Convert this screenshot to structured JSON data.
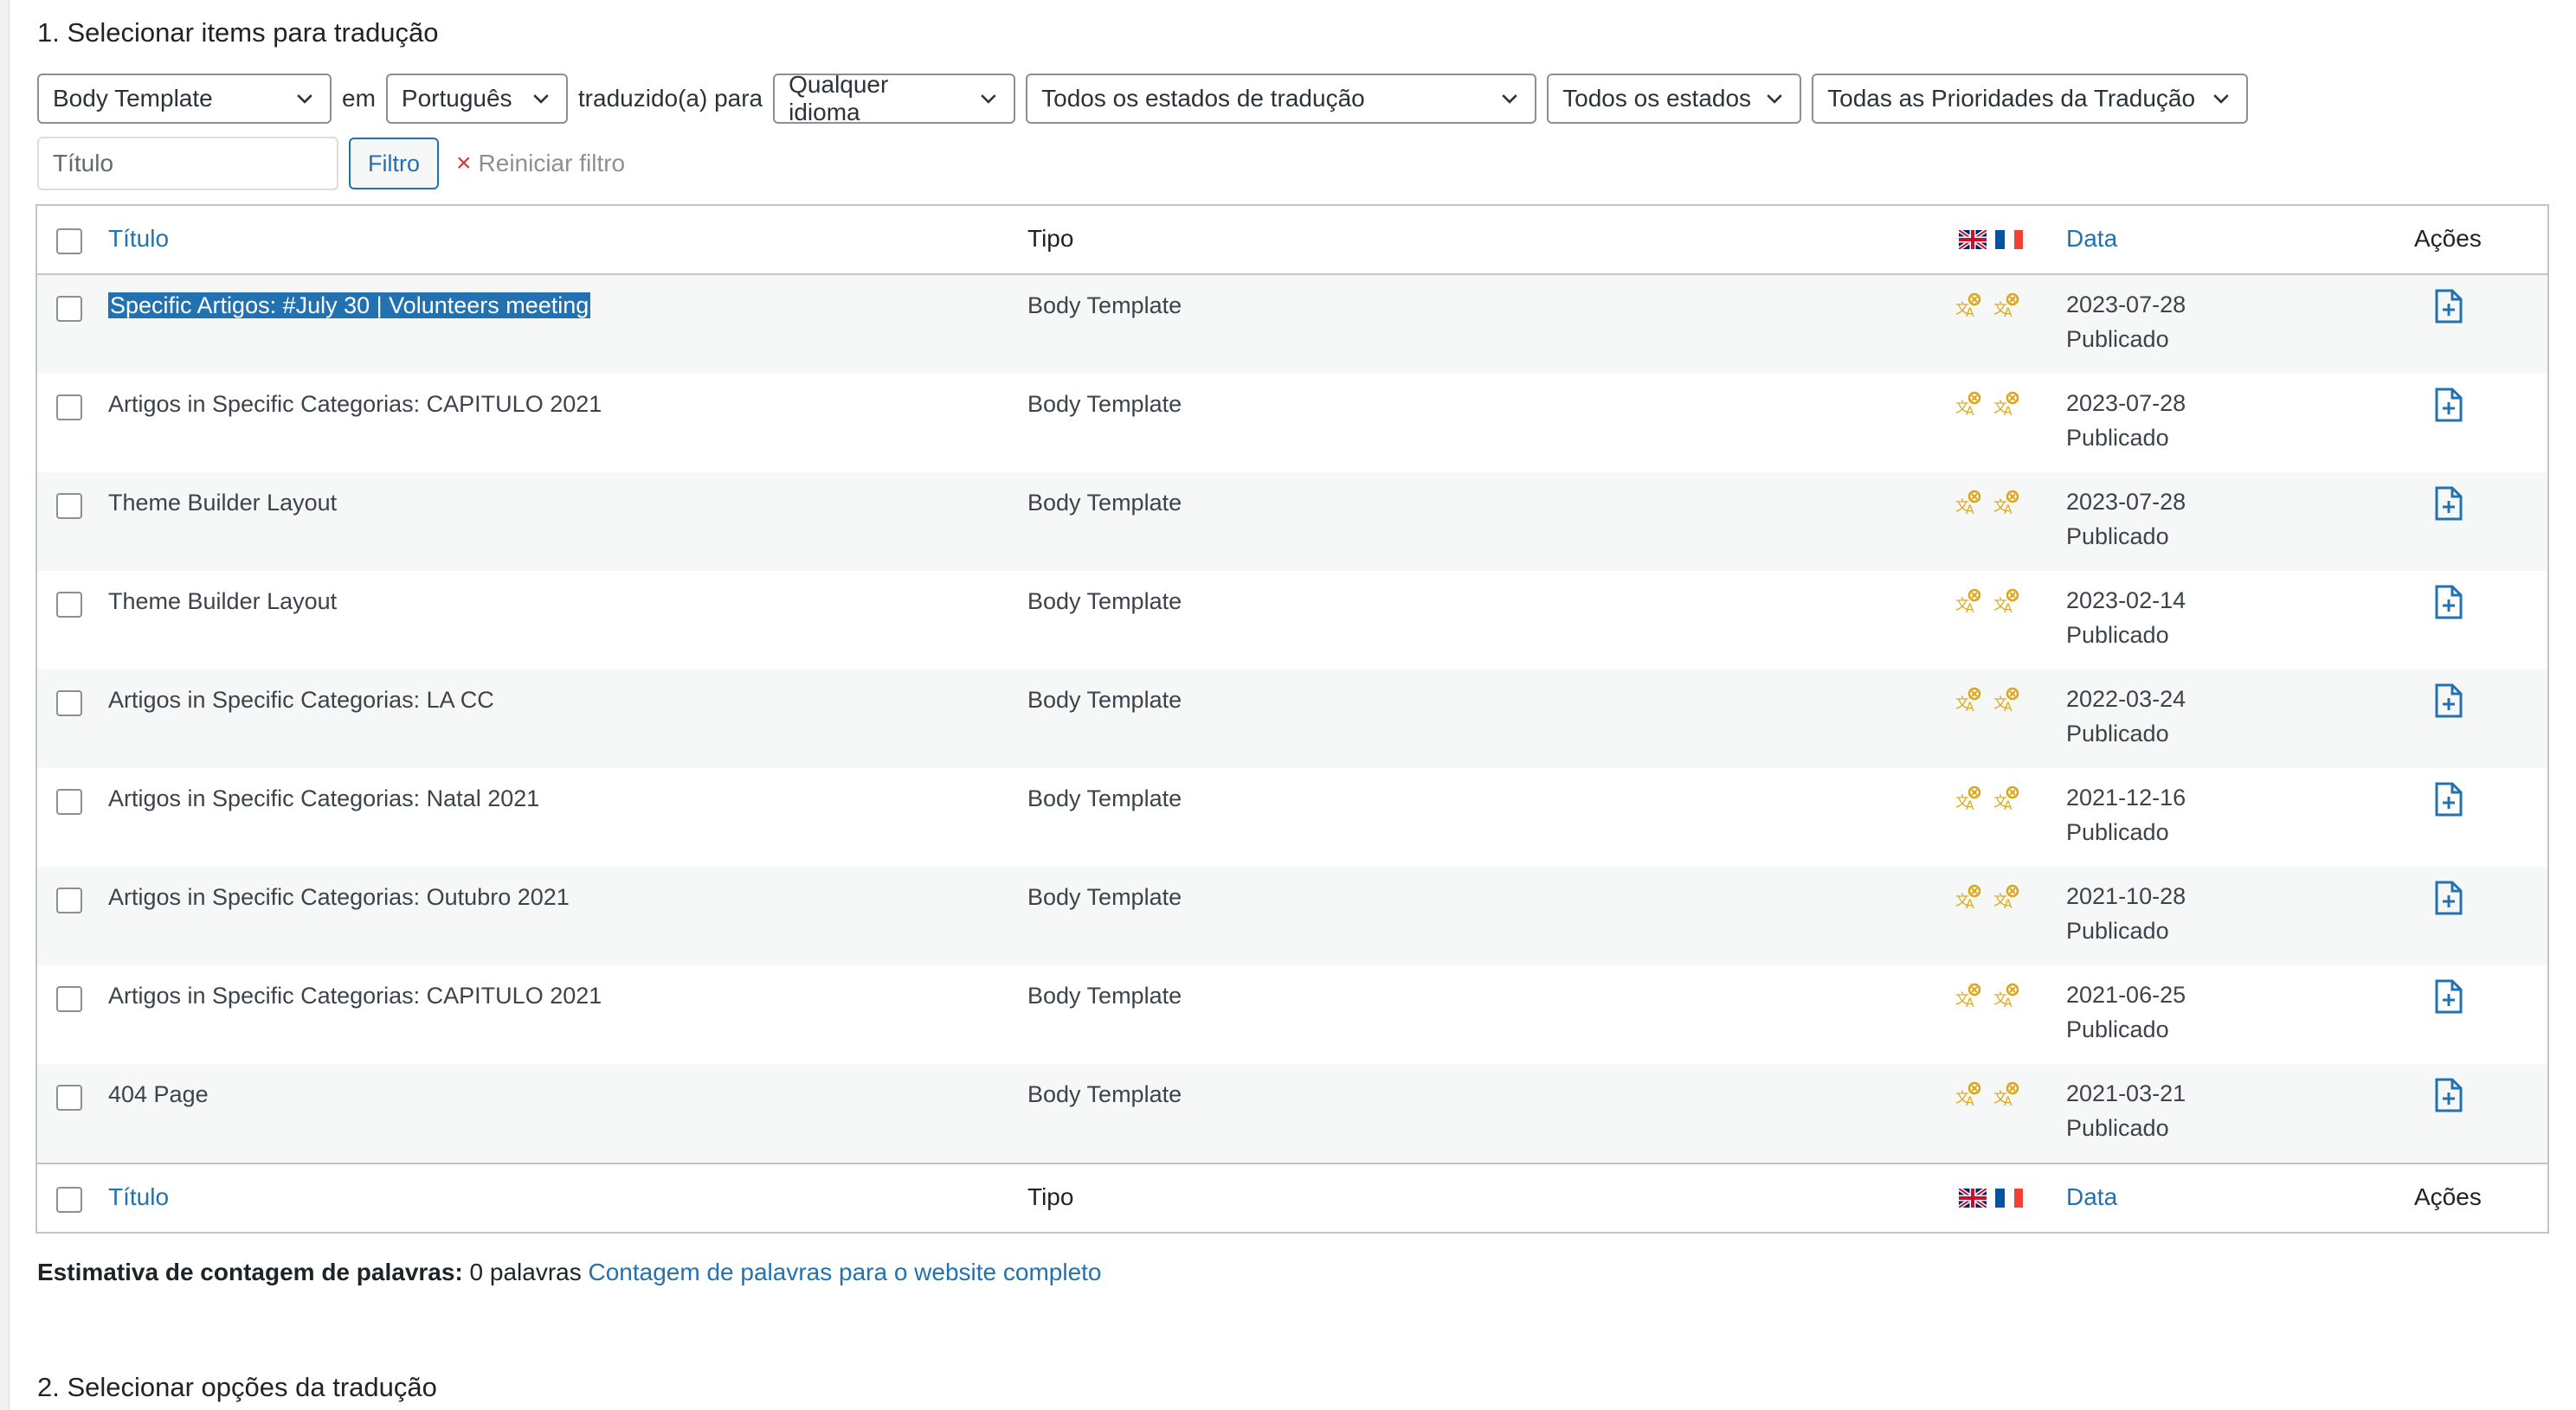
{
  "section1_title": "1. Selecionar items para tradução",
  "section2_title": "2. Selecionar opções da tradução",
  "filters": {
    "type_select": "Body Template",
    "in_label": "em",
    "language_select": "Português",
    "translated_to_label": "traduzido(a) para",
    "target_select": "Qualquer idioma",
    "translation_status_select": "Todos os estados de tradução",
    "status_select": "Todos os estados",
    "priority_select": "Todas as Prioridades da Tradução",
    "title_placeholder": "Título",
    "filter_button": "Filtro",
    "reset_label": "Reiniciar filtro"
  },
  "table": {
    "headers": {
      "title": "Título",
      "type": "Tipo",
      "date": "Data",
      "actions": "Ações"
    },
    "rows": [
      {
        "title": "Specific Artigos: #July 30 | Volunteers meeting",
        "type": "Body Template",
        "date": "2023-07-28",
        "status": "Publicado"
      },
      {
        "title": "Artigos in Specific Categorias: CAPITULO 2021",
        "type": "Body Template",
        "date": "2023-07-28",
        "status": "Publicado"
      },
      {
        "title": "Theme Builder Layout",
        "type": "Body Template",
        "date": "2023-07-28",
        "status": "Publicado"
      },
      {
        "title": "Theme Builder Layout",
        "type": "Body Template",
        "date": "2023-02-14",
        "status": "Publicado"
      },
      {
        "title": "Artigos in Specific Categorias: LA CC",
        "type": "Body Template",
        "date": "2022-03-24",
        "status": "Publicado"
      },
      {
        "title": "Artigos in Specific Categorias: Natal 2021",
        "type": "Body Template",
        "date": "2021-12-16",
        "status": "Publicado"
      },
      {
        "title": "Artigos in Specific Categorias: Outubro 2021",
        "type": "Body Template",
        "date": "2021-10-28",
        "status": "Publicado"
      },
      {
        "title": "Artigos in Specific Categorias: CAPITULO 2021",
        "type": "Body Template",
        "date": "2021-06-25",
        "status": "Publicado"
      },
      {
        "title": "404 Page",
        "type": "Body Template",
        "date": "2021-03-21",
        "status": "Publicado"
      }
    ]
  },
  "word_count": {
    "label": "Estimativa de contagem de palavras:",
    "value": "0 palavras",
    "link": "Contagem de palavras para o website completo"
  },
  "colors": {
    "link": "#2271b1",
    "translate_icon": "#dba617",
    "selection": "#2271b1"
  },
  "icons": {
    "flags": [
      "uk-flag-icon",
      "france-flag-icon"
    ],
    "row_status": "translate-needed-icon",
    "row_action": "add-document-icon"
  }
}
